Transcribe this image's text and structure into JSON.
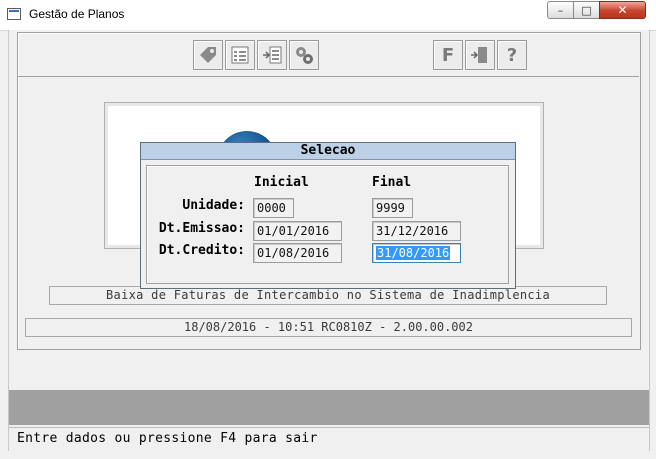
{
  "window": {
    "title": "Gestão de Planos",
    "controls": {
      "minimize": "–",
      "maximize": "□",
      "close": "✕"
    }
  },
  "toolbar": {
    "icons": [
      "tag-icon",
      "checklist-icon",
      "list-arrow-icon",
      "gears-icon",
      "function-f-icon",
      "exit-door-icon",
      "help-question-icon"
    ],
    "glyphs": {
      "function": "F",
      "help": "?"
    }
  },
  "info_bar": "Baixa de Faturas de Intercambio no Sistema de Inadimplencia",
  "version_bar": "18/08/2016 - 10:51  RC0810Z - 2.00.00.002",
  "dialog": {
    "title": "Selecao",
    "col_inicial": "Inicial",
    "col_final": "Final",
    "rows": [
      {
        "label": "Unidade:",
        "inicial": "0000",
        "final": "9999"
      },
      {
        "label": "Dt.Emissao:",
        "inicial": "01/01/2016",
        "final": "31/12/2016"
      },
      {
        "label": "Dt.Credito:",
        "inicial": "01/08/2016",
        "final": "31/08/2016"
      }
    ]
  },
  "status": "Entre dados ou pressione F4 para sair",
  "colors": {
    "selection": "#3399ff",
    "dialog_title_bg": "#bcd0e6",
    "gray_band": "#a0a0a0"
  }
}
